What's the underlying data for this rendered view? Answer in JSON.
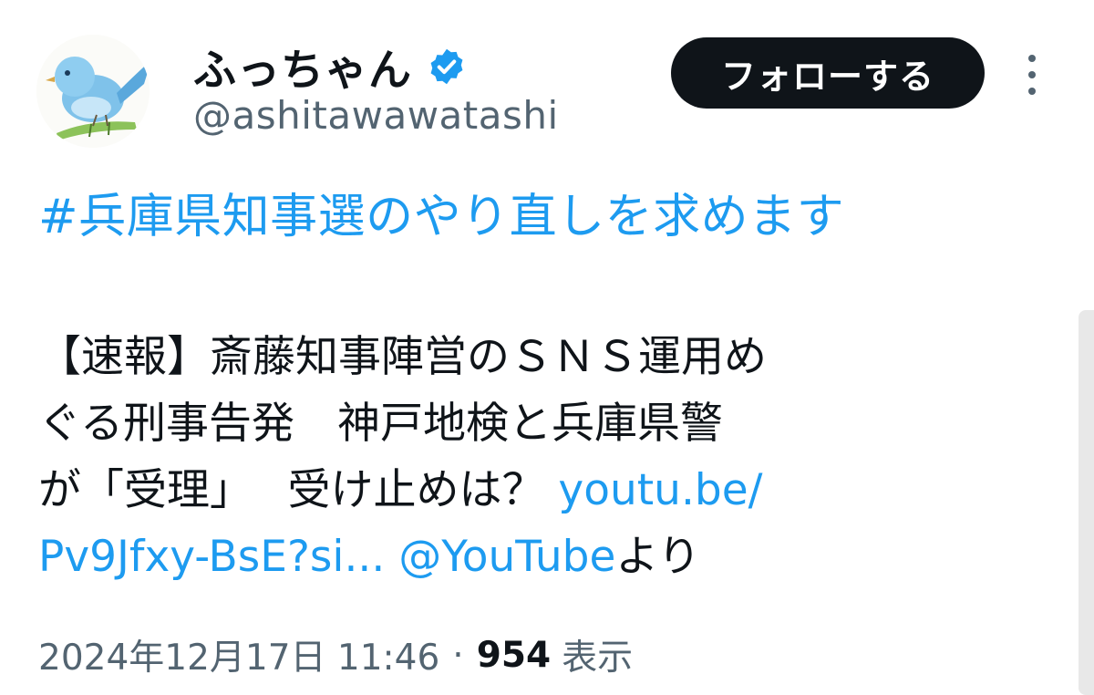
{
  "author": {
    "display_name": "ふっちゃん",
    "handle": "@ashitawawatashi",
    "verified_icon": "verified-badge-icon",
    "avatar_icon": "bluebird-avatar"
  },
  "actions": {
    "follow_label": "フォローする",
    "more_icon": "more-vertical-icon"
  },
  "tweet": {
    "hashtag": "#兵庫県知事選のやり直しを求めます",
    "line1": "【速報】斎藤知事陣営のＳＮＳ運用め",
    "line2": "ぐる刑事告発　神戸地検と兵庫県警",
    "line3_text": "が「受理」　 受け止めは？ ",
    "line3_link": "youtu.be/",
    "line4_link": "Pv9Jfxy-BsE?si...",
    "line4_space": " ",
    "line4_mention": "@YouTube",
    "line4_suffix": "より"
  },
  "meta": {
    "timestamp": "2024年12月17日 11:46",
    "separator": "·",
    "views_count": "954",
    "views_label": "表示"
  },
  "colors": {
    "accent": "#1d9bf0",
    "text": "#0f1419",
    "secondary": "#536471",
    "button_bg": "#0f1419"
  }
}
